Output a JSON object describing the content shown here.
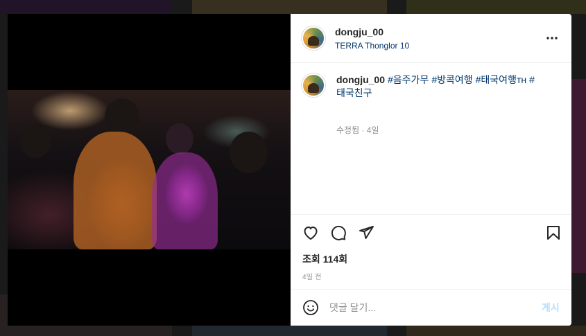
{
  "post": {
    "author": {
      "username": "dongju_00",
      "location": "TERRA Thonglor 10",
      "avatar_icon": "profile-avatar"
    },
    "caption": {
      "username": "dongju_00",
      "hashtags_line1": [
        "#음주가무",
        "#방콕여행",
        "#태국여행ᴛʜ",
        "#"
      ],
      "hashtags_line2": [
        "태국친구"
      ],
      "meta": "수정됨 · 4일"
    },
    "views": "조회 114회",
    "date": "4일 전",
    "comment": {
      "placeholder": "댓글 달기...",
      "submit_label": "게시"
    }
  },
  "icons": {
    "more": "more-horizontal-icon",
    "like": "heart-icon",
    "comment": "comment-bubble-icon",
    "share": "send-icon",
    "save": "bookmark-icon",
    "emoji": "emoji-smile-icon"
  },
  "colors": {
    "link": "#00376b",
    "muted": "#8e8e8e",
    "text": "#262626",
    "post_button_disabled": "#b2dffc",
    "backdrop": "#3a3a3a"
  }
}
